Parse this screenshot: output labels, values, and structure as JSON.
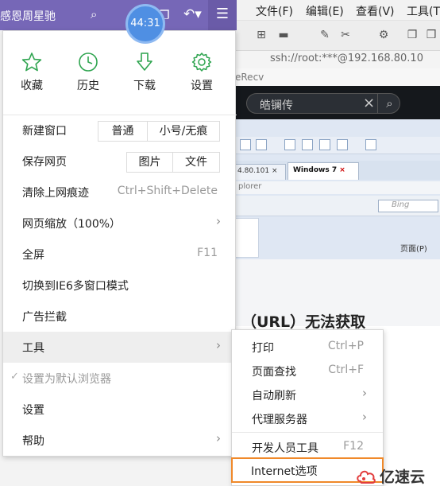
{
  "window": {
    "title": "感恩周星驰",
    "timer": "44:31"
  },
  "quick_actions": [
    {
      "label": "收藏",
      "icon": "star-icon"
    },
    {
      "label": "历史",
      "icon": "clock-icon"
    },
    {
      "label": "下载",
      "icon": "download-icon"
    },
    {
      "label": "设置",
      "icon": "gear-icon"
    }
  ],
  "menu": {
    "new_window": "新建窗口",
    "new_window_opts": [
      "普通",
      "小号/无痕"
    ],
    "save_page": "保存网页",
    "save_page_opts": [
      "图片",
      "文件"
    ],
    "clear_traces": "清除上网痕迹",
    "clear_traces_shortcut": "Ctrl+Shift+Delete",
    "zoom": "网页缩放（100%）",
    "fullscreen": "全屏",
    "fullscreen_shortcut": "F11",
    "ie6_mode": "切换到IE6多窗口模式",
    "adblock": "广告拦截",
    "tools": "工具",
    "default_browser": "设置为默认浏览器",
    "settings": "设置",
    "help": "帮助"
  },
  "tools_submenu": {
    "print": "打印",
    "print_shortcut": "Ctrl+P",
    "find": "页面查找",
    "find_shortcut": "Ctrl+F",
    "auto_refresh": "自动刷新",
    "proxy": "代理服务器",
    "devtools": "开发人员工具",
    "devtools_shortcut": "F12",
    "internet_options": "Internet选项"
  },
  "background_app": {
    "menus": [
      "文件(F)",
      "编辑(E)",
      "查看(V)",
      "工具(T"
    ],
    "ssh": "ssh://root:***@192.168.80.10",
    "recv": "eRecv",
    "search_query": "皓镧传",
    "ie_tab_1": "4.80.101",
    "ie_tab_2": "Windows 7",
    "ie_explorer": "plorer",
    "ie_bing": "Bing",
    "ie_page_menu": "页面(P)",
    "doc_heading": "（URL）无法获取"
  },
  "watermark": "亿速云",
  "colors": {
    "titlebar": "#7667b7",
    "timer": "#4f8fe3",
    "icon_green": "#2ea44f",
    "highlight_border": "#f0892a"
  }
}
